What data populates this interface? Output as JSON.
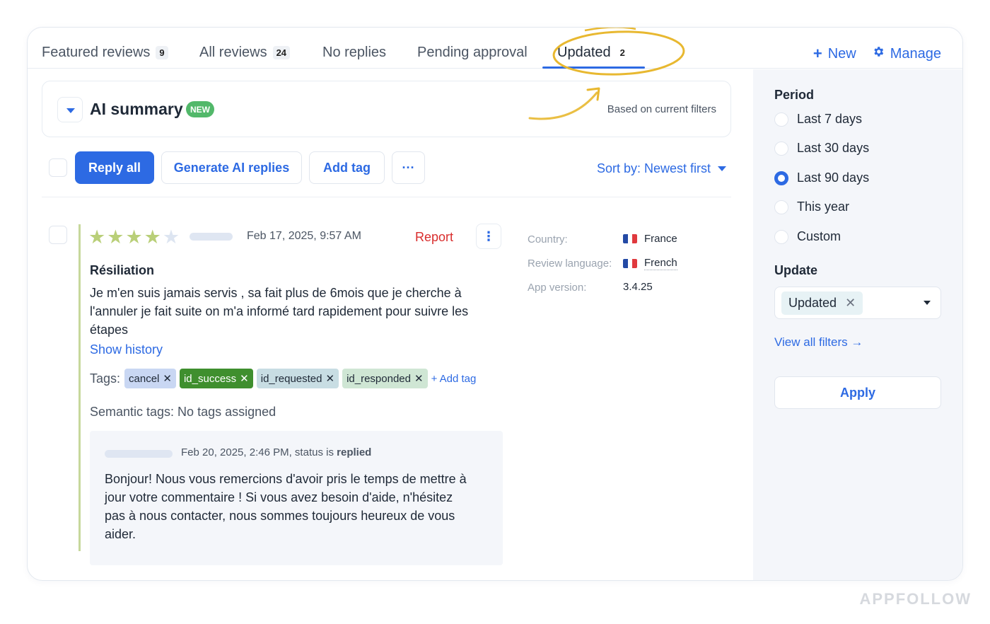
{
  "tabs": [
    {
      "label": "Featured reviews",
      "count": "9"
    },
    {
      "label": "All reviews",
      "count": "24"
    },
    {
      "label": "No replies",
      "count": ""
    },
    {
      "label": "Pending approval",
      "count": ""
    },
    {
      "label": "Updated",
      "count": "2",
      "active": true
    }
  ],
  "top_actions": {
    "new_label": "New",
    "manage_label": "Manage",
    "new_icon": "plus-icon",
    "manage_icon": "gear-icon"
  },
  "ai_summary": {
    "title": "AI summary",
    "badge": "NEW",
    "note": "Based on current filters"
  },
  "toolbar": {
    "reply_all": "Reply all",
    "generate": "Generate AI replies",
    "add_tag": "Add tag",
    "more": "···",
    "sort": "Sort by: Newest first"
  },
  "review": {
    "rating": 4,
    "max_rating": 5,
    "date": "Feb 17, 2025, 9:57 AM",
    "report": "Report",
    "title": "Résiliation",
    "body": "Je m'en suis jamais servis , sa fait plus de 6mois que je cherche à l'annuler je fait suite on m'a informé tard rapidement pour suivre les étapes",
    "show_history": "Show history",
    "tags_label": "Tags:",
    "tags": [
      {
        "label": "cancel",
        "color": "#c9d7f3"
      },
      {
        "label": "id_success",
        "color": "#3f8f2e",
        "text_color": "#ffffff"
      },
      {
        "label": "id_requested",
        "color": "#c8dde3"
      },
      {
        "label": "id_responded",
        "color": "#cfe6d4"
      }
    ],
    "add_tag_link": "+ Add tag",
    "semantic_tags": "Semantic tags: No tags assigned",
    "meta": {
      "country_label": "Country:",
      "country": "France",
      "language_label": "Review language:",
      "language": "French",
      "version_label": "App version:",
      "version": "3.4.25"
    },
    "reply": {
      "date_prefix": "Feb 20, 2025, 2:46 PM, status is",
      "status": "replied",
      "body": "Bonjour! Nous vous remercions d'avoir pris le temps de mettre à jour votre commentaire ! Si vous avez besoin d'aide, n'hésitez pas à nous contacter, nous sommes toujours heureux de vous aider."
    }
  },
  "sidebar": {
    "period_label": "Period",
    "period_options": [
      {
        "label": "Last 7 days",
        "checked": false
      },
      {
        "label": "Last 30 days",
        "checked": false
      },
      {
        "label": "Last 90 days",
        "checked": true
      },
      {
        "label": "This year",
        "checked": false
      },
      {
        "label": "Custom",
        "checked": false
      }
    ],
    "update_label": "Update",
    "update_value": "Updated",
    "view_all": "View all filters →",
    "apply": "Apply"
  },
  "colors": {
    "accent": "#2d6ae3",
    "highlight": "#e8b830",
    "report": "#d92d2d"
  },
  "watermark": "APPFOLLOW"
}
